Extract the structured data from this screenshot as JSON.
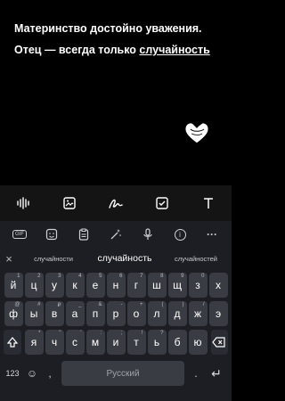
{
  "note": {
    "line1": "Материнство достойно уважения.",
    "line2_prefix": "Отец — всегда только ",
    "line2_underlined": "случайность"
  },
  "toolbar": {
    "icons": [
      "audio-wave-icon",
      "image-icon",
      "handwriting-icon",
      "checkbox-icon",
      "text-icon"
    ]
  },
  "keyboard": {
    "top_icons": [
      "GIF",
      "sticker",
      "clipboard",
      "magic",
      "mic",
      "info",
      "more"
    ],
    "gif_label": "GIF",
    "info_label": "i",
    "more_label": "···",
    "close_label": "×",
    "suggestions": [
      "случайности",
      "случайность",
      "случайностей"
    ],
    "row1": [
      [
        "й",
        "1"
      ],
      [
        "ц",
        "2"
      ],
      [
        "у",
        "3"
      ],
      [
        "к",
        "4"
      ],
      [
        "е",
        "5"
      ],
      [
        "н",
        "6"
      ],
      [
        "г",
        "7"
      ],
      [
        "ш",
        "8"
      ],
      [
        "щ",
        "9"
      ],
      [
        "з",
        "0"
      ],
      [
        "х",
        ""
      ]
    ],
    "row2": [
      [
        "ф",
        "@"
      ],
      [
        "ы",
        "#"
      ],
      [
        "в",
        "₽"
      ],
      [
        "а",
        "_"
      ],
      [
        "п",
        "&"
      ],
      [
        "р",
        "-"
      ],
      [
        "о",
        "+"
      ],
      [
        "л",
        "("
      ],
      [
        "д",
        ")"
      ],
      [
        "ж",
        "/"
      ],
      [
        "э",
        ""
      ]
    ],
    "row3": [
      [
        "я",
        "*"
      ],
      [
        "ч",
        "\""
      ],
      [
        "с",
        "'"
      ],
      [
        "м",
        ":"
      ],
      [
        "и",
        ";"
      ],
      [
        "т",
        "!"
      ],
      [
        "ь",
        "?"
      ],
      [
        "б",
        ""
      ],
      [
        "ю",
        ""
      ]
    ],
    "numbers_label": "123",
    "emoji_label": "☺",
    "comma_label": ",",
    "space_label": "Русский",
    "period_label": ".",
    "enter_label": "↵"
  },
  "colors": {
    "background": "#000000",
    "keyboard_bg": "#1d1e24",
    "key_bg": "#3a3c43",
    "toolbar_bg": "#141414"
  }
}
